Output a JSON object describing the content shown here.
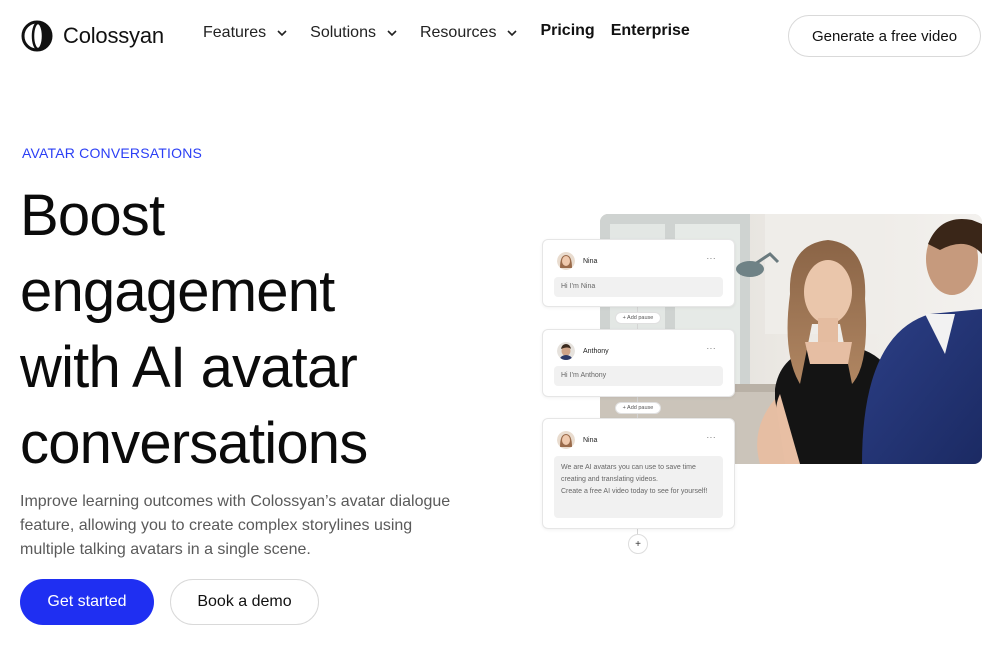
{
  "nav": {
    "logo_text": "Colossyan",
    "items": [
      {
        "label": "Features",
        "has_dropdown": true
      },
      {
        "label": "Solutions",
        "has_dropdown": true
      },
      {
        "label": "Resources",
        "has_dropdown": true
      },
      {
        "label": "Pricing",
        "has_dropdown": false
      },
      {
        "label": "Enterprise",
        "has_dropdown": false
      }
    ],
    "cta_label": "Generate a free video"
  },
  "hero": {
    "eyebrow": "AVATAR CONVERSATIONS",
    "headline_lines": [
      "Boost",
      "engagement",
      "with AI avatar",
      "conversations"
    ],
    "subtext": "Improve learning outcomes with Colossyan’s avatar dialogue feature, allowing you to create complex storylines using multiple talking avatars in a single scene.",
    "primary_button": "Get started",
    "secondary_button": "Book a demo"
  },
  "conversation": {
    "cards": [
      {
        "name": "Nina",
        "message": "Hi I’m Nina",
        "menu": "···"
      },
      {
        "name": "Anthony",
        "message": "Hi I’m Anthony",
        "menu": "···"
      },
      {
        "name": "Nina",
        "message": "We are AI avatars you can use to save time creating and translating videos.\nCreate a free AI video today to see for yourself!",
        "menu": "···"
      }
    ],
    "add_pause_label": "+ Add pause",
    "add_icon": "+"
  },
  "colors": {
    "accent": "#1f2ff2",
    "eyebrow": "#2a3ef5",
    "text": "#0b0b0b",
    "muted": "#5a5a5a"
  }
}
